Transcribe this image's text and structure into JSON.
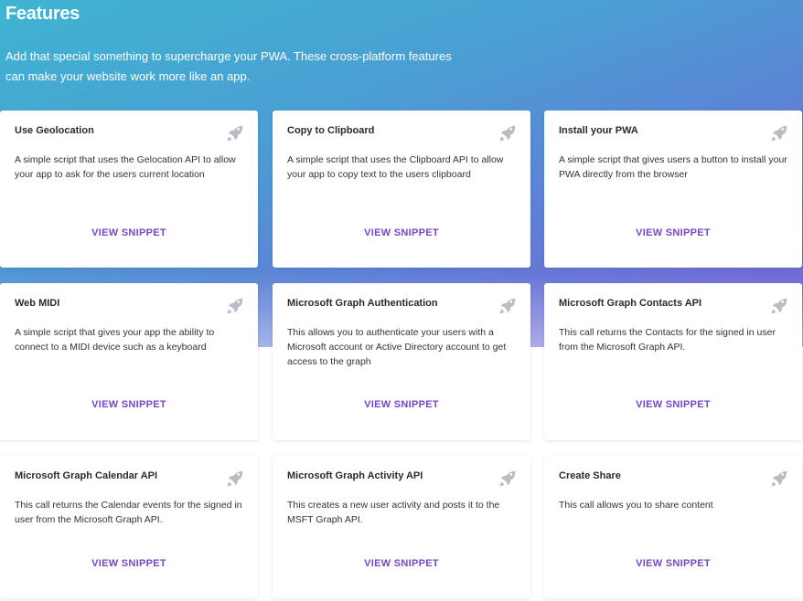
{
  "header": {
    "title": "Features",
    "description": "Add that special something to supercharge your PWA. These cross-platform features can make your website work more like an app."
  },
  "cards": [
    {
      "title": "Use Geolocation",
      "description": "A simple script that uses the Gelocation API to allow your app to ask for the users current location",
      "link": "VIEW SNIPPET",
      "icon": "rocket-icon"
    },
    {
      "title": "Copy to Clipboard",
      "description": "A simple script that uses the Clipboard API to allow your app to copy text to the users clipboard",
      "link": "VIEW SNIPPET",
      "icon": "rocket-icon"
    },
    {
      "title": "Install your PWA",
      "description": "A simple script that gives users a button to install your PWA directly from the browser",
      "link": "VIEW SNIPPET",
      "icon": "rocket-icon"
    },
    {
      "title": "Web MIDI",
      "description": "A simple script that gives your app the ability to connect to a MIDI device such as a keyboard",
      "link": "VIEW SNIPPET",
      "icon": "rocket-icon"
    },
    {
      "title": "Microsoft Graph Authentication",
      "description": "This allows you to authenticate your users with a Microsoft account or Active Directory account to get access to the graph",
      "link": "VIEW SNIPPET",
      "icon": "rocket-icon"
    },
    {
      "title": "Microsoft Graph Contacts API",
      "description": "This call returns the Contacts for the signed in user from the Microsoft Graph API.",
      "link": "VIEW SNIPPET",
      "icon": "rocket-icon"
    },
    {
      "title": "Microsoft Graph Calendar API",
      "description": "This call returns the Calendar events for the signed in user from the Microsoft Graph API.",
      "link": "VIEW SNIPPET",
      "icon": "rocket-icon"
    },
    {
      "title": "Microsoft Graph Activity API",
      "description": "This creates a new user activity and posts it to the MSFT Graph API.",
      "link": "VIEW SNIPPET",
      "icon": "rocket-icon"
    },
    {
      "title": "Create Share",
      "description": "This call allows you to share content",
      "link": "VIEW SNIPPET",
      "icon": "rocket-icon"
    }
  ],
  "colors": {
    "gradient_start": "#3fb4d2",
    "gradient_end": "#7a5fd6",
    "link": "#7a45c9",
    "icon": "#b9bcc4"
  }
}
